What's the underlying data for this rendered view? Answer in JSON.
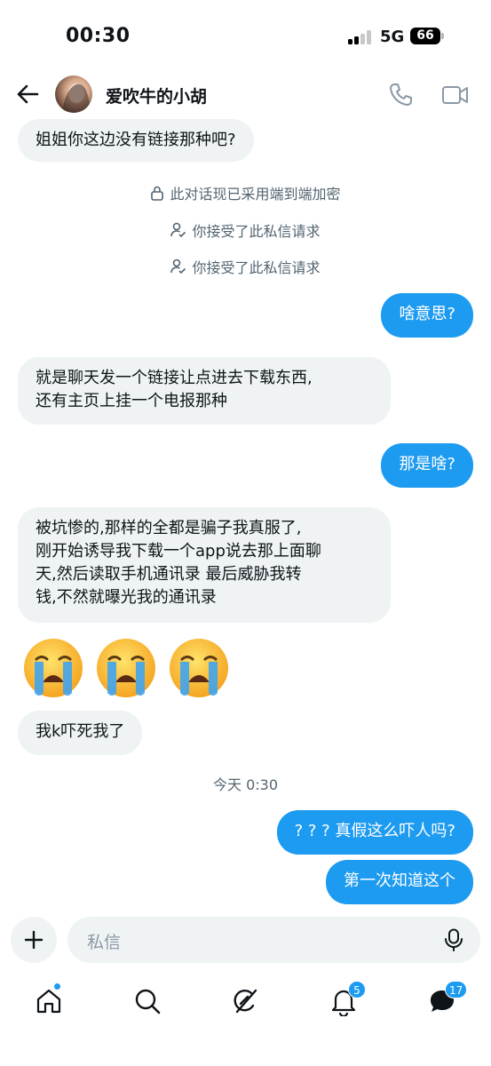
{
  "status_bar": {
    "time": "00:30",
    "network": "5G",
    "battery": "66"
  },
  "header": {
    "back_icon": "arrow-left-icon",
    "contact_name": "爱吹牛的小胡",
    "call_icon": "phone-icon",
    "video_icon": "video-camera-icon"
  },
  "messages": [
    {
      "direction": "in",
      "text": "姐姐你这边没有链接那种吧?"
    },
    {
      "direction": "system",
      "icon": "lock-icon",
      "text": "此对话现已采用端到端加密"
    },
    {
      "direction": "system",
      "icon": "user-check-icon",
      "text": "你接受了此私信请求"
    },
    {
      "direction": "system",
      "icon": "user-check-icon",
      "text": "你接受了此私信请求"
    },
    {
      "direction": "out",
      "text": "啥意思?"
    },
    {
      "direction": "in",
      "lines": [
        "就是聊天发一个链接让点进去下载东西,",
        "还有主页上挂一个电报那种"
      ]
    },
    {
      "direction": "out",
      "text": "那是啥?"
    },
    {
      "direction": "in",
      "lines": [
        "被坑惨的,那样的全都是骗子我真服了,",
        "刚开始诱导我下载一个app说去那上面聊",
        "天,然后读取手机通讯录 最后威胁我转",
        "钱,不然就曝光我的通讯录"
      ]
    },
    {
      "direction": "in",
      "emoji": "loudly-crying-face-emoji",
      "count": 3
    },
    {
      "direction": "in",
      "text": "我k吓死我了"
    },
    {
      "direction": "out",
      "text": "? ? ? 真假这么吓人吗?"
    },
    {
      "direction": "out",
      "text": "第一次知道这个"
    }
  ],
  "timestamp": "今天 0:30",
  "composer": {
    "add_icon": "plus-icon",
    "placeholder": "私信",
    "mic_icon": "microphone-icon"
  },
  "nav": [
    {
      "name": "home",
      "icon": "home-icon",
      "has_dot": true
    },
    {
      "name": "search",
      "icon": "search-icon"
    },
    {
      "name": "grok",
      "icon": "grok-icon"
    },
    {
      "name": "notifications",
      "icon": "bell-icon",
      "badge": "5"
    },
    {
      "name": "messages",
      "icon": "messages-icon",
      "badge": "17"
    }
  ],
  "colors": {
    "accent": "#1d9bf0",
    "incoming_bubble": "#eff3f4",
    "text": "#0f1419",
    "muted": "#536471"
  }
}
